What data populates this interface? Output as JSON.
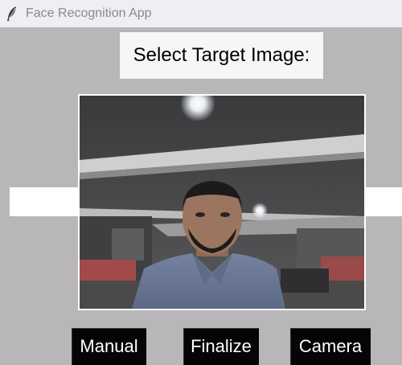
{
  "window": {
    "title": "Face Recognition App",
    "icon": "feather-icon"
  },
  "heading": "Select Target Image:",
  "image": {
    "description_icon": "camera-preview-image"
  },
  "buttons": {
    "manual": "Manual",
    "finalize": "Finalize",
    "camera": "Camera"
  },
  "colors": {
    "window_bg": "#b8b6b9",
    "titlebar_bg": "#efeef3",
    "button_bg": "#050505",
    "button_text": "#ffffff"
  }
}
